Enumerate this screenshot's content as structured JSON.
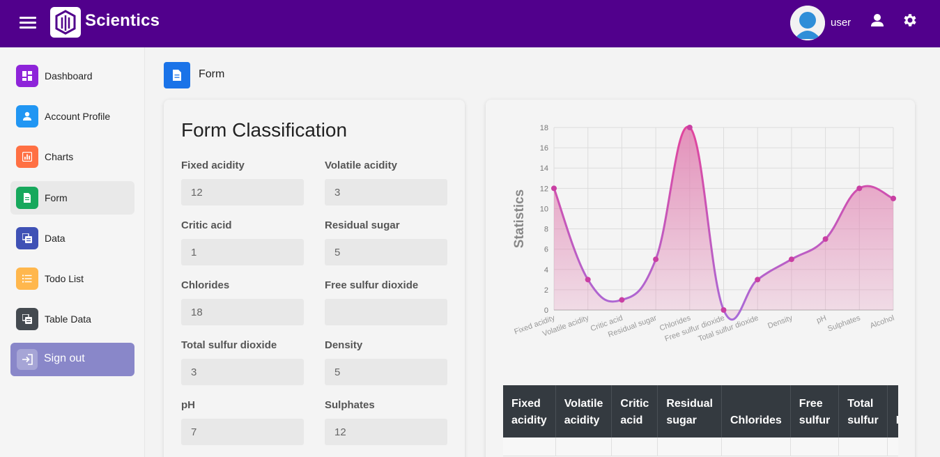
{
  "app": {
    "name": "Scientics",
    "user": "user"
  },
  "sidebar": {
    "items": [
      {
        "label": "Dashboard",
        "icon": "dashboard-icon",
        "color": "#8e24d9"
      },
      {
        "label": "Account Profile",
        "icon": "person-icon",
        "color": "#2196f3"
      },
      {
        "label": "Charts",
        "icon": "chart-icon",
        "color": "#ff7043"
      },
      {
        "label": "Form",
        "icon": "document-icon",
        "color": "#17a85c",
        "active": true
      },
      {
        "label": "Data",
        "icon": "data-icon",
        "color": "#3f51b5"
      },
      {
        "label": "Todo List",
        "icon": "list-icon",
        "color": "#ffb74d"
      },
      {
        "label": "Table Data",
        "icon": "table-icon",
        "color": "#444a50"
      }
    ],
    "signout": "Sign out"
  },
  "page": {
    "title": "Form"
  },
  "form": {
    "title": "Form Classification",
    "fields": [
      {
        "label": "Fixed acidity",
        "value": "12"
      },
      {
        "label": "Volatile acidity",
        "value": "3"
      },
      {
        "label": "Critic acid",
        "value": "1"
      },
      {
        "label": "Residual sugar",
        "value": "5"
      },
      {
        "label": "Chlorides",
        "value": "18"
      },
      {
        "label": "Free sulfur dioxide",
        "value": ""
      },
      {
        "label": "Total sulfur dioxide",
        "value": "3"
      },
      {
        "label": "Density",
        "value": "5"
      },
      {
        "label": "pH",
        "value": "7"
      },
      {
        "label": "Sulphates",
        "value": "12"
      }
    ]
  },
  "chart_data": {
    "type": "area",
    "categories": [
      "Fixed acidity",
      "Volatile acidity",
      "Critic acid",
      "Residual sugar",
      "Chlorides",
      "Free sulfur dioxide",
      "Total sulfur dioxide",
      "Density",
      "pH",
      "Sulphates",
      "Alcohol"
    ],
    "series": [
      {
        "values": [
          12,
          3,
          1,
          5,
          18,
          0,
          3,
          5,
          7,
          12,
          11
        ]
      }
    ],
    "ylabel": "Statistics",
    "xlabel": "",
    "ylim": [
      0,
      18
    ],
    "yticks": [
      0,
      2,
      4,
      6,
      8,
      10,
      12,
      14,
      16,
      18
    ],
    "grid": true,
    "colors": {
      "line_top": "#e2449c",
      "line_bottom": "#a86ad8",
      "fill": "#e07fb0",
      "point": "#c93fa3"
    }
  },
  "table": {
    "headers": [
      [
        "Fixed",
        "acidity"
      ],
      [
        "Volatile",
        "acidity"
      ],
      [
        "Critic",
        "acid"
      ],
      [
        "Residual",
        "sugar"
      ],
      [
        "",
        "Chlorides"
      ],
      [
        "Free",
        "sulfur"
      ],
      [
        "Total",
        "sulfur"
      ],
      [
        "",
        "D"
      ]
    ]
  }
}
